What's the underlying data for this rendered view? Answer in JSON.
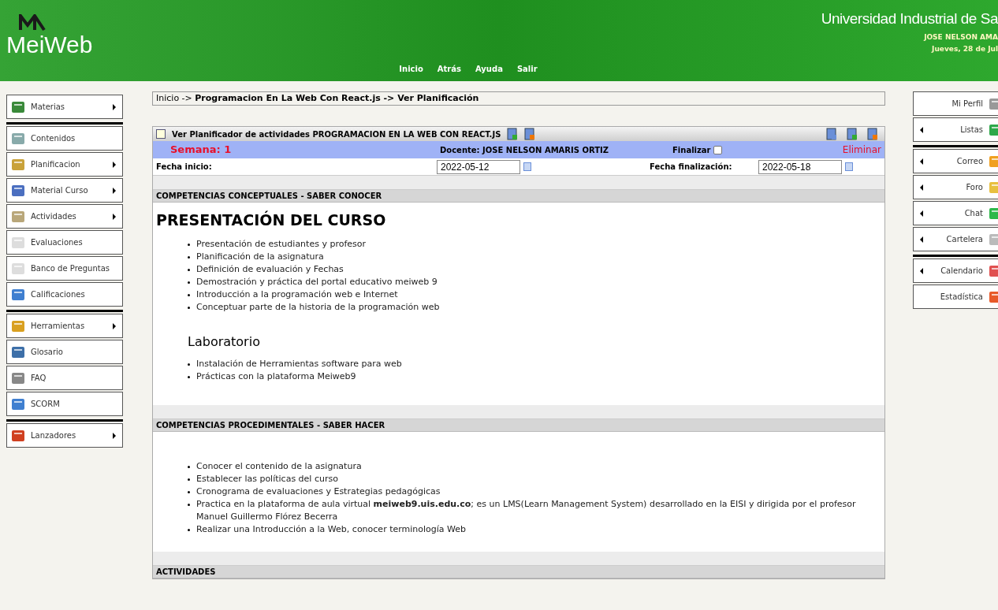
{
  "header": {
    "logo": "MeiWeb",
    "nav": [
      "Inicio",
      "Atrás",
      "Ayuda",
      "Salir"
    ],
    "institution": "Universidad Industrial de Sa",
    "user": "JOSE NELSON AMA",
    "date": "Jueves, 28 de Jul"
  },
  "left_menu": {
    "groups": [
      [
        {
          "label": "Materias",
          "submenu": true
        }
      ],
      [
        {
          "label": "Contenidos",
          "submenu": false
        },
        {
          "label": "Planificacion",
          "submenu": true
        },
        {
          "label": "Material Curso",
          "submenu": true
        },
        {
          "label": "Actividades",
          "submenu": true
        },
        {
          "label": "Evaluaciones",
          "submenu": false
        },
        {
          "label": "Banco de Preguntas",
          "submenu": false
        },
        {
          "label": "Calificaciones",
          "submenu": false
        }
      ],
      [
        {
          "label": "Herramientas",
          "submenu": true
        },
        {
          "label": "Glosario",
          "submenu": false
        },
        {
          "label": "FAQ",
          "submenu": false
        },
        {
          "label": "SCORM",
          "submenu": false
        }
      ],
      [
        {
          "label": "Lanzadores",
          "submenu": true
        }
      ]
    ]
  },
  "right_menu": {
    "groups": [
      [
        {
          "label": "Mi Perfil",
          "submenu": false
        },
        {
          "label": "Listas",
          "submenu": true
        }
      ],
      [
        {
          "label": "Correo",
          "submenu": true
        },
        {
          "label": "Foro",
          "submenu": true
        },
        {
          "label": "Chat",
          "submenu": true
        },
        {
          "label": "Cartelera",
          "submenu": true
        }
      ],
      [
        {
          "label": "Calendario",
          "submenu": true
        },
        {
          "label": "Estadística",
          "submenu": false
        }
      ]
    ]
  },
  "breadcrumb": "Inicio -> **Programacion En La Web Con React.js -> Ver Planificación**",
  "planner": {
    "title": "Ver Planificador de actividades PROGRAMACION EN LA WEB CON REACT.JS",
    "week": "Semana: 1",
    "teacher": "Docente: JOSE NELSON AMARIS ORTIZ",
    "finish": {
      "label": "Finalizar",
      "checked": false
    },
    "delete": "Eliminar",
    "start": {
      "label": "Fecha inicio:",
      "value": "2022-05-12"
    },
    "end": {
      "label": "Fecha finalización:",
      "value": "2022-05-18"
    }
  },
  "sections": [
    {
      "heading": "COMPETENCIAS CONCEPTUALES - SABER CONOCER",
      "blocks": [
        {
          "kind": "title",
          "text": "PRESENTACIÓN DEL CURSO"
        },
        {
          "kind": "list",
          "items": [
            "Presentación de estudiantes y profesor",
            "Planificación  de la asignatura",
            "Definición de evaluación y Fechas",
            "Demostración y práctica del portal educativo meiweb 9",
            "Introducción a la programación web e Internet",
            "Conceptuar parte de  la historia de la programación web"
          ]
        },
        {
          "kind": "subtitle",
          "text": "Laboratorio"
        },
        {
          "kind": "list",
          "items": [
            "Instalación de Herramientas software para web",
            "Prácticas con la plataforma Meiweb9"
          ]
        }
      ]
    },
    {
      "heading": "COMPETENCIAS PROCEDIMENTALES - SABER HACER",
      "blocks": [
        {
          "kind": "list",
          "items": [
            "Conocer el contenido de la asignatura",
            "Establecer las políticas del curso",
            "Cronograma de evaluaciones y Estrategias pedagógicas",
            "Practica en  la plataforma de aula virtual **meiweb9.uis.edu.co**; es un LMS(Learn Management System) desarrollado en la EISI y dirigida por el profesor Manuel Guillermo Flórez Becerra",
            "Realizar una Introducción a la Web,  conocer terminología Web"
          ]
        }
      ]
    },
    {
      "heading": "ACTIVIDADES"
    }
  ]
}
